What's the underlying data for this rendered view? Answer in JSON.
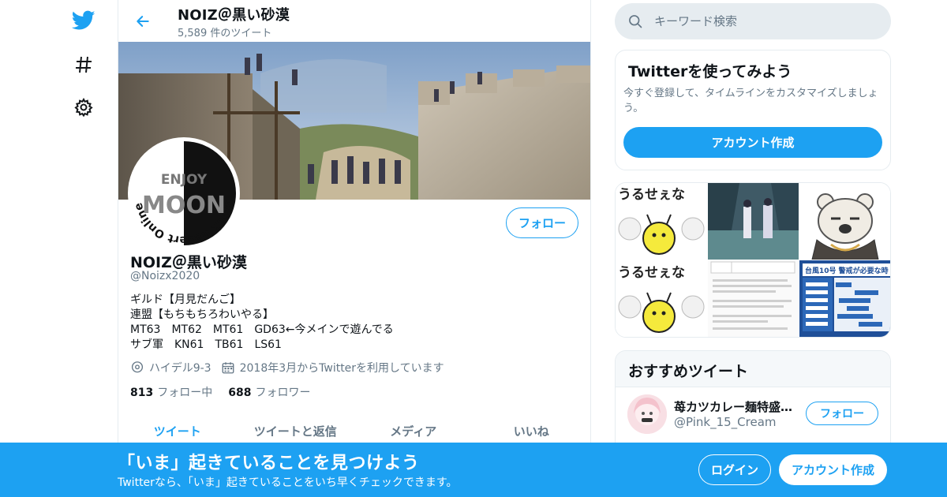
{
  "nav": {
    "icons": [
      "twitter-logo-icon",
      "hashtag-icon",
      "gear-icon"
    ]
  },
  "header": {
    "title": "NOIZ＠黒い砂漠",
    "tweet_count": "5,589 件のツイート"
  },
  "profile": {
    "avatar_text_top": "ENJOY",
    "avatar_text_main": "MOON",
    "avatar_text_ring": "Black desert Online",
    "name": "NOIZ＠黒い砂漠",
    "handle": "@Noizx2020",
    "follow_label": "フォロー",
    "bio": [
      "ギルド【月見だんご】",
      "連盟【もちもちろわいやる】",
      "MT63　MT62　MT61　GD63←今メインで遊んでる",
      "サブ軍　KN61　TB61　LS61"
    ],
    "location": "ハイデル9-3",
    "joined": "2018年3月からTwitterを利用しています",
    "following_count": "813",
    "following_label": "フォロー中",
    "followers_count": "688",
    "followers_label": "フォロワー"
  },
  "tabs": [
    {
      "label": "ツイート",
      "active": true
    },
    {
      "label": "ツイートと返信",
      "active": false
    },
    {
      "label": "メディア",
      "active": false
    },
    {
      "label": "いいね",
      "active": false
    }
  ],
  "search": {
    "placeholder": "キーワード検索"
  },
  "signup_card": {
    "title": "Twitterを使ってみよう",
    "description": "今すぐ登録して、タイムラインをカスタマイズしましょう。",
    "button": "アカウント作成"
  },
  "media_card": {
    "sticker_text": "うるせぇな",
    "notice_title": "台風10号 警戒が必要な時"
  },
  "recommended": {
    "title": "おすすめツイート",
    "user": {
      "name": "苺カツカレー麺特盛…",
      "handle": "@Pink_15_Cream",
      "follow_label": "フォロー"
    }
  },
  "bottom_bar": {
    "title": "「いま」起きていることを見つけよう",
    "subtitle": "Twitterなら、「いま」起きていることをいち早くチェックできます。",
    "login": "ログイン",
    "signup": "アカウント作成"
  },
  "colors": {
    "accent": "#1da1f2",
    "text_secondary": "#657786",
    "border": "#e6ecf0"
  }
}
